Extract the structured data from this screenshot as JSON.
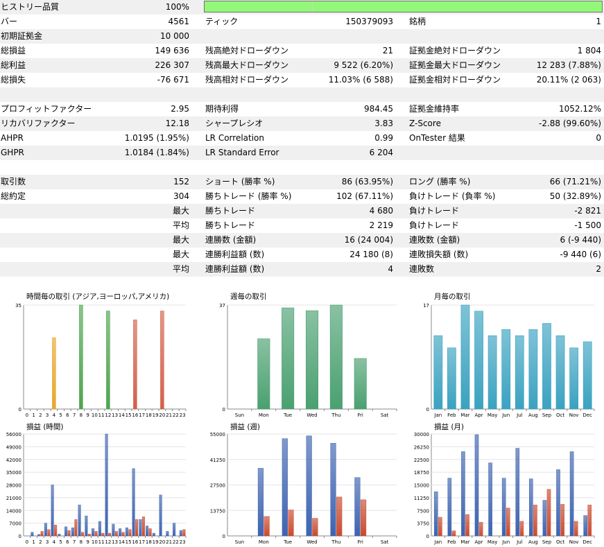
{
  "stats": {
    "history_quality": {
      "label": "ヒストリー品質",
      "value": "100%",
      "progress": 1.0
    },
    "rows": [
      {
        "c": [
          [
            "バー",
            "4561"
          ],
          [
            "ティック",
            "150379093"
          ],
          [
            "銘柄",
            "1"
          ]
        ]
      },
      {
        "c": [
          [
            "初期証拠金",
            "10 000"
          ],
          [
            "",
            ""
          ],
          [
            "",
            ""
          ]
        ]
      },
      {
        "c": [
          [
            "総損益",
            "149 636"
          ],
          [
            "残高絶対ドローダウン",
            "21"
          ],
          [
            "証拠金絶対ドローダウン",
            "1 804"
          ]
        ]
      },
      {
        "c": [
          [
            "総利益",
            "226 307"
          ],
          [
            "残高最大ドローダウン",
            "9 522 (6.20%)"
          ],
          [
            "証拠金最大ドローダウン",
            "12 283 (7.88%)"
          ]
        ]
      },
      {
        "c": [
          [
            "総損失",
            "-76 671"
          ],
          [
            "残高相対ドローダウン",
            "11.03% (6 588)"
          ],
          [
            "証拠金相対ドローダウン",
            "20.11% (2 063)"
          ]
        ]
      },
      {
        "c": [
          [
            "",
            ""
          ],
          [
            "",
            ""
          ],
          [
            "",
            ""
          ]
        ]
      },
      {
        "c": [
          [
            "プロフィットファクター",
            "2.95"
          ],
          [
            "期待利得",
            "984.45"
          ],
          [
            "証拠金維持率",
            "1052.12%"
          ]
        ]
      },
      {
        "c": [
          [
            "リカバリファクター",
            "12.18"
          ],
          [
            "シャープレシオ",
            "3.83"
          ],
          [
            "Z-Score",
            "-2.88 (99.60%)"
          ]
        ]
      },
      {
        "c": [
          [
            "AHPR",
            "1.0195 (1.95%)"
          ],
          [
            "LR Correlation",
            "0.99"
          ],
          [
            "OnTester 結果",
            "0"
          ]
        ]
      },
      {
        "c": [
          [
            "GHPR",
            "1.0184 (1.84%)"
          ],
          [
            "LR Standard Error",
            "6 204"
          ],
          [
            "",
            ""
          ]
        ]
      },
      {
        "c": [
          [
            "",
            ""
          ],
          [
            "",
            ""
          ],
          [
            "",
            ""
          ]
        ]
      },
      {
        "c": [
          [
            "取引数",
            "152"
          ],
          [
            "ショート (勝率 %)",
            "86 (63.95%)"
          ],
          [
            "ロング (勝率 %)",
            "66 (71.21%)"
          ]
        ]
      },
      {
        "c": [
          [
            "総約定",
            "304"
          ],
          [
            "勝ちトレード (勝率 %)",
            "102 (67.11%)"
          ],
          [
            "負けトレード (負率 %)",
            "50 (32.89%)"
          ]
        ]
      },
      {
        "c": [
          [
            "",
            "最大"
          ],
          [
            "勝ちトレード",
            "4 680"
          ],
          [
            "負けトレード",
            "-2 821"
          ]
        ]
      },
      {
        "c": [
          [
            "",
            "平均"
          ],
          [
            "勝ちトレード",
            "2 219"
          ],
          [
            "負けトレード",
            "-1 500"
          ]
        ]
      },
      {
        "c": [
          [
            "",
            "最大"
          ],
          [
            "連勝数 (金額)",
            "16 (24 004)"
          ],
          [
            "連敗数 (金額)",
            "6 (-9 440)"
          ]
        ]
      },
      {
        "c": [
          [
            "",
            "最大"
          ],
          [
            "連勝利益額 (数)",
            "24 180 (8)"
          ],
          [
            "連敗損失額 (数)",
            "-9 440 (6)"
          ]
        ]
      },
      {
        "c": [
          [
            "",
            "平均"
          ],
          [
            "連勝利益額 (数)",
            "4"
          ],
          [
            "連敗数",
            "2"
          ]
        ]
      },
      {
        "c": [
          [
            "",
            ""
          ],
          [
            "",
            ""
          ],
          [
            "",
            ""
          ]
        ]
      }
    ]
  },
  "colors": {
    "asia": "#e8a52a",
    "europe": "#4ea44e",
    "america": "#d3604a",
    "week": "#4aa070",
    "month": "#3aa2c0",
    "profit": "#3d63b0",
    "loss": "#c94a2e"
  },
  "chart_data": [
    {
      "id": "hourly_trades",
      "type": "bar",
      "title": "時間毎の取引 (アジア,ヨーロッパ,アメリカ)",
      "categories": [
        "0",
        "1",
        "2",
        "3",
        "4",
        "5",
        "6",
        "7",
        "8",
        "9",
        "10",
        "11",
        "12",
        "13",
        "14",
        "15",
        "16",
        "17",
        "18",
        "19",
        "20",
        "21",
        "22",
        "23"
      ],
      "values": [
        0,
        0,
        0,
        0,
        24,
        0,
        0,
        0,
        35,
        0,
        0,
        0,
        33,
        0,
        0,
        0,
        30,
        0,
        0,
        0,
        33,
        0,
        0,
        0
      ],
      "yticks": [
        "35",
        "0"
      ],
      "ylim": [
        0,
        35
      ]
    },
    {
      "id": "weekly_trades",
      "type": "bar",
      "title": "週毎の取引",
      "categories": [
        "Sun",
        "Mon",
        "Tue",
        "Wed",
        "Thu",
        "Fri",
        "Sat"
      ],
      "values": [
        0,
        25,
        36,
        35,
        37,
        18,
        0
      ],
      "yticks": [
        "37",
        "0"
      ],
      "ylim": [
        0,
        37
      ]
    },
    {
      "id": "monthly_trades",
      "type": "bar",
      "title": "月毎の取引",
      "categories": [
        "Jan",
        "Feb",
        "Mar",
        "Apr",
        "May",
        "Jun",
        "Jul",
        "Aug",
        "Sep",
        "Oct",
        "Nov",
        "Dec"
      ],
      "values": [
        12,
        10,
        17,
        16,
        12,
        13,
        12,
        13,
        14,
        12,
        10,
        11
      ],
      "yticks": [
        "17",
        "0"
      ],
      "ylim": [
        0,
        17
      ]
    },
    {
      "id": "hourly_pnl",
      "type": "bar",
      "title": "損益 (時間)",
      "categories": [
        "0",
        "1",
        "2",
        "3",
        "4",
        "5",
        "6",
        "7",
        "8",
        "9",
        "10",
        "11",
        "12",
        "13",
        "14",
        "15",
        "16",
        "17",
        "18",
        "19",
        "20",
        "21",
        "22",
        "23"
      ],
      "series": [
        {
          "values": [
            0,
            2000,
            800,
            7000,
            28000,
            1000,
            5000,
            4500,
            17000,
            11000,
            4000,
            8000,
            56000,
            6500,
            4000,
            4500,
            37000,
            9000,
            5500,
            1500,
            22500,
            2500,
            7000,
            3000
          ]
        },
        {
          "values": [
            0,
            0,
            2500,
            3500,
            6000,
            0,
            3000,
            9000,
            2000,
            1000,
            2500,
            1500,
            1500,
            2500,
            2000,
            3500,
            9000,
            10500,
            4000,
            0,
            0,
            0,
            0,
            3500
          ]
        }
      ],
      "yticks": [
        "56000",
        "49000",
        "42000",
        "35000",
        "28000",
        "21000",
        "14000",
        "7000",
        "0"
      ],
      "ylim": [
        0,
        56000
      ]
    },
    {
      "id": "weekly_pnl",
      "type": "bar",
      "title": "損益 (週)",
      "categories": [
        "Sun",
        "Mon",
        "Tue",
        "Wed",
        "Thu",
        "Fri",
        "Sat"
      ],
      "series": [
        {
          "values": [
            0,
            36500,
            52500,
            54000,
            50000,
            31500,
            0
          ]
        },
        {
          "values": [
            0,
            10500,
            14000,
            9500,
            21000,
            19500,
            0
          ]
        }
      ],
      "yticks": [
        "55000",
        "41250",
        "27500",
        "13750",
        "0"
      ],
      "ylim": [
        0,
        55000
      ]
    },
    {
      "id": "monthly_pnl",
      "type": "bar",
      "title": "損益 (月)",
      "categories": [
        "Jan",
        "Feb",
        "Mar",
        "Apr",
        "May",
        "Jun",
        "Jul",
        "Aug",
        "Sep",
        "Oct",
        "Nov",
        "Dec"
      ],
      "series": [
        {
          "values": [
            13000,
            17000,
            24800,
            29800,
            21500,
            17000,
            25800,
            16800,
            10500,
            19500,
            24800,
            6000
          ]
        },
        {
          "values": [
            5500,
            1500,
            6300,
            4000,
            0,
            8200,
            4300,
            9100,
            13700,
            9300,
            4300,
            9100
          ]
        }
      ],
      "yticks": [
        "30000",
        "26250",
        "22500",
        "18750",
        "15000",
        "11250",
        "7500",
        "3750",
        "0"
      ],
      "ylim": [
        0,
        30000
      ]
    }
  ]
}
